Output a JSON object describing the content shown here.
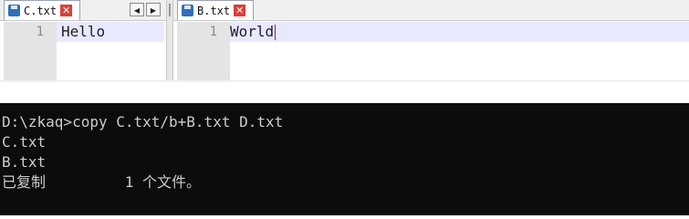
{
  "editor_left": {
    "tab_label": "C.txt",
    "line_number": "1",
    "content": "Hello"
  },
  "editor_right": {
    "tab_label": "B.txt",
    "line_number": "1",
    "content": "World"
  },
  "tab_controls": {
    "prev_icon": "◀",
    "next_icon": "▶",
    "close_icon": "✕"
  },
  "console": {
    "lines": [
      "D:\\zkaq>copy C.txt/b+B.txt D.txt",
      "C.txt",
      "B.txt",
      "已复制         1 个文件。"
    ]
  },
  "colors": {
    "console_bg": "#0c0c0c",
    "console_text": "#cccccc",
    "line_highlight": "#e8e8ff",
    "caret": "#7b1fa2",
    "close_red": "#d9403a",
    "disk_blue": "#2f6fb5"
  }
}
